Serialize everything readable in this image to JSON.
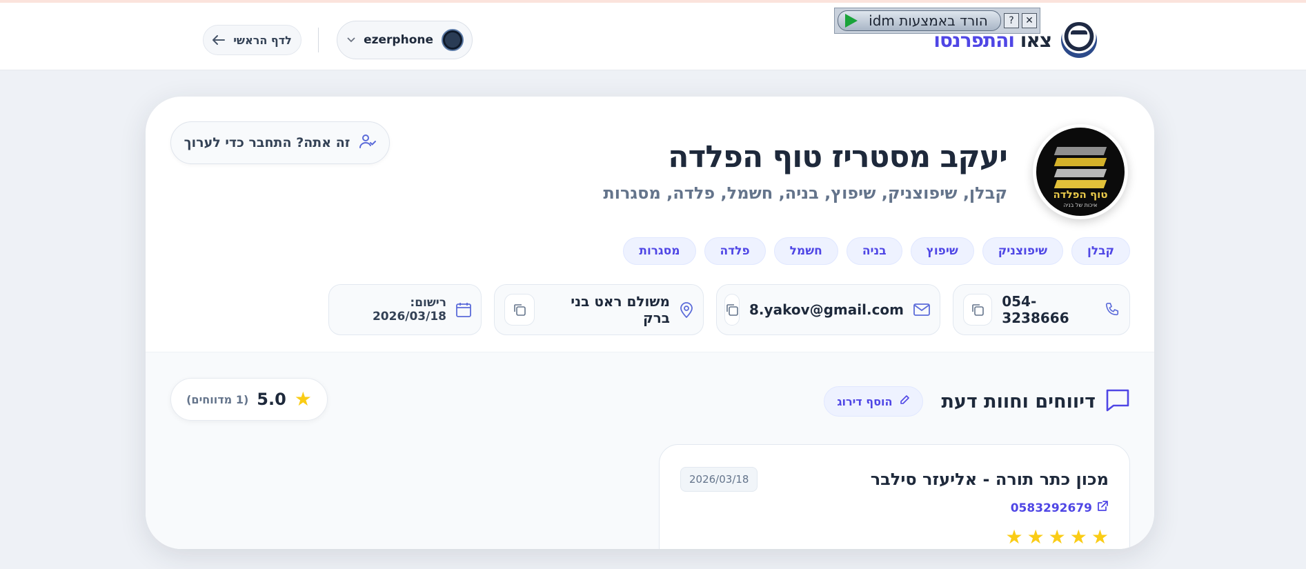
{
  "header": {
    "logo_text_dark": "צאו",
    "logo_text_accent": "והתפרנסו",
    "idm_label": "הורד באמצעות idm",
    "idm_help": "?",
    "idm_close": "✕",
    "account_name": "ezerphone",
    "home_label": "לדף הראשי"
  },
  "profile": {
    "avatar_brand": "טוף הפלדה",
    "avatar_tagline": "איכות של בניה",
    "title": "יעקב מסטריז טוף הפלדה",
    "subtitle": "קבלן, שיפוצניק, שיפוץ, בניה, חשמל, פלדה, מסגרות",
    "claim_label": "זה אתה? התחבר כדי לערוך",
    "tags": [
      "קבלן",
      "שיפוצניק",
      "שיפוץ",
      "בניה",
      "חשמל",
      "פלדה",
      "מסגרות"
    ],
    "phone": "054-3238666",
    "email": "8.yakov@gmail.com",
    "location": "משולם ראט בני ברק",
    "registered": "רישום: 2026/03/18"
  },
  "reviews": {
    "heading": "דיווחים וחוות דעת",
    "add_rating": "הוסף דירוג",
    "score": "5.0",
    "count": "(1 מדווחים)",
    "items": [
      {
        "name": "מכון כתר תורה - אליעזר סילבר",
        "phone": "0583292679",
        "date": "2026/03/18",
        "stars": 5
      }
    ]
  },
  "colors": {
    "accent": "#4f46e5",
    "star": "#facc15",
    "background": "#eef1f6"
  }
}
